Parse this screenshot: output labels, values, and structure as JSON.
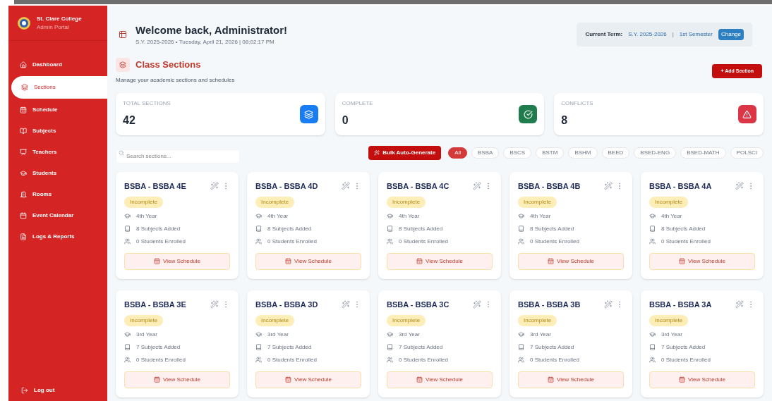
{
  "sidebar": {
    "college_name": "St. Clare College",
    "portal_label": "Admin Portal",
    "items": [
      {
        "label": "Dashboard",
        "selected": false
      },
      {
        "label": "Sections",
        "selected": true
      },
      {
        "label": "Schedule",
        "selected": false
      },
      {
        "label": "Subjects",
        "selected": false
      },
      {
        "label": "Teachers",
        "selected": false
      },
      {
        "label": "Students",
        "selected": false
      },
      {
        "label": "Rooms",
        "selected": false
      },
      {
        "label": "Event Calendar",
        "selected": false
      },
      {
        "label": "Logs & Reports",
        "selected": false
      }
    ],
    "logout": "Log out"
  },
  "header": {
    "title": "Welcome back, Administrator!",
    "subtitle": "S.Y. 2025-2026 • Tuesday, April 21, 2026 | 08:02:17 PM",
    "term_label": "Current Term:",
    "term_year": "S.Y. 2025-2026",
    "term_separator": "|",
    "term_semester": "1st Semester",
    "change_button": "Change"
  },
  "page": {
    "title": "Class Sections",
    "description": "Manage your academic sections and schedules",
    "add_button": "+ Add Section"
  },
  "stats": [
    {
      "label": "TOTAL SECTIONS",
      "value": "42",
      "color": "#1a7cf2"
    },
    {
      "label": "COMPLETE",
      "value": "0",
      "color": "#1f7d4d"
    },
    {
      "label": "CONFLICTS",
      "value": "8",
      "color": "#dc3545"
    }
  ],
  "toolbar": {
    "search_placeholder": "Search sections...",
    "bulk_button": "Bulk Auto-Generate",
    "filters": [
      {
        "label": "All",
        "selected": true
      },
      {
        "label": "BSBA",
        "selected": false
      },
      {
        "label": "BSCS",
        "selected": false
      },
      {
        "label": "BSTM",
        "selected": false
      },
      {
        "label": "BSHM",
        "selected": false
      },
      {
        "label": "BEED",
        "selected": false
      },
      {
        "label": "BSED-ENG",
        "selected": false
      },
      {
        "label": "BSED-MATH",
        "selected": false
      },
      {
        "label": "POLSCI",
        "selected": false
      }
    ]
  },
  "sections": [
    {
      "name": "BSBA - BSBA 4E",
      "status": "Incomplete",
      "year": "4th Year",
      "subjects": "8 Subjects Added",
      "students": "0 Students Enrolled",
      "button": "View Schedule"
    },
    {
      "name": "BSBA - BSBA 4D",
      "status": "Incomplete",
      "year": "4th Year",
      "subjects": "8 Subjects Added",
      "students": "0 Students Enrolled",
      "button": "View Schedule"
    },
    {
      "name": "BSBA - BSBA 4C",
      "status": "Incomplete",
      "year": "4th Year",
      "subjects": "8 Subjects Added",
      "students": "0 Students Enrolled",
      "button": "View Schedule"
    },
    {
      "name": "BSBA - BSBA 4B",
      "status": "Incomplete",
      "year": "4th Year",
      "subjects": "8 Subjects Added",
      "students": "0 Students Enrolled",
      "button": "View Schedule"
    },
    {
      "name": "BSBA - BSBA 4A",
      "status": "Incomplete",
      "year": "4th Year",
      "subjects": "8 Subjects Added",
      "students": "0 Students Enrolled",
      "button": "View Schedule"
    },
    {
      "name": "BSBA - BSBA 3E",
      "status": "Incomplete",
      "year": "3rd Year",
      "subjects": "7 Subjects Added",
      "students": "0 Students Enrolled",
      "button": "View Schedule"
    },
    {
      "name": "BSBA - BSBA 3D",
      "status": "Incomplete",
      "year": "3rd Year",
      "subjects": "7 Subjects Added",
      "students": "0 Students Enrolled",
      "button": "View Schedule"
    },
    {
      "name": "BSBA - BSBA 3C",
      "status": "Incomplete",
      "year": "3rd Year",
      "subjects": "7 Subjects Added",
      "students": "0 Students Enrolled",
      "button": "View Schedule"
    },
    {
      "name": "BSBA - BSBA 3B",
      "status": "Incomplete",
      "year": "3rd Year",
      "subjects": "7 Subjects Added",
      "students": "0 Students Enrolled",
      "button": "View Schedule"
    },
    {
      "name": "BSBA - BSBA 3A",
      "status": "Incomplete",
      "year": "3rd Year",
      "subjects": "7 Subjects Added",
      "students": "0 Students Enrolled",
      "button": "View Schedule"
    }
  ]
}
